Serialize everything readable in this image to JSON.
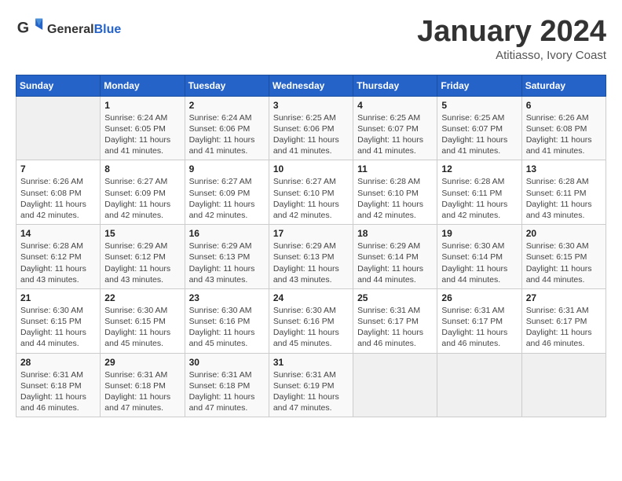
{
  "header": {
    "logo_general": "General",
    "logo_blue": "Blue",
    "month_title": "January 2024",
    "location": "Atitiasso, Ivory Coast"
  },
  "days_of_week": [
    "Sunday",
    "Monday",
    "Tuesday",
    "Wednesday",
    "Thursday",
    "Friday",
    "Saturday"
  ],
  "weeks": [
    [
      {
        "day": "",
        "info": ""
      },
      {
        "day": "1",
        "info": "Sunrise: 6:24 AM\nSunset: 6:05 PM\nDaylight: 11 hours and 41 minutes."
      },
      {
        "day": "2",
        "info": "Sunrise: 6:24 AM\nSunset: 6:06 PM\nDaylight: 11 hours and 41 minutes."
      },
      {
        "day": "3",
        "info": "Sunrise: 6:25 AM\nSunset: 6:06 PM\nDaylight: 11 hours and 41 minutes."
      },
      {
        "day": "4",
        "info": "Sunrise: 6:25 AM\nSunset: 6:07 PM\nDaylight: 11 hours and 41 minutes."
      },
      {
        "day": "5",
        "info": "Sunrise: 6:25 AM\nSunset: 6:07 PM\nDaylight: 11 hours and 41 minutes."
      },
      {
        "day": "6",
        "info": "Sunrise: 6:26 AM\nSunset: 6:08 PM\nDaylight: 11 hours and 41 minutes."
      }
    ],
    [
      {
        "day": "7",
        "info": "Sunrise: 6:26 AM\nSunset: 6:08 PM\nDaylight: 11 hours and 42 minutes."
      },
      {
        "day": "8",
        "info": "Sunrise: 6:27 AM\nSunset: 6:09 PM\nDaylight: 11 hours and 42 minutes."
      },
      {
        "day": "9",
        "info": "Sunrise: 6:27 AM\nSunset: 6:09 PM\nDaylight: 11 hours and 42 minutes."
      },
      {
        "day": "10",
        "info": "Sunrise: 6:27 AM\nSunset: 6:10 PM\nDaylight: 11 hours and 42 minutes."
      },
      {
        "day": "11",
        "info": "Sunrise: 6:28 AM\nSunset: 6:10 PM\nDaylight: 11 hours and 42 minutes."
      },
      {
        "day": "12",
        "info": "Sunrise: 6:28 AM\nSunset: 6:11 PM\nDaylight: 11 hours and 42 minutes."
      },
      {
        "day": "13",
        "info": "Sunrise: 6:28 AM\nSunset: 6:11 PM\nDaylight: 11 hours and 43 minutes."
      }
    ],
    [
      {
        "day": "14",
        "info": "Sunrise: 6:28 AM\nSunset: 6:12 PM\nDaylight: 11 hours and 43 minutes."
      },
      {
        "day": "15",
        "info": "Sunrise: 6:29 AM\nSunset: 6:12 PM\nDaylight: 11 hours and 43 minutes."
      },
      {
        "day": "16",
        "info": "Sunrise: 6:29 AM\nSunset: 6:13 PM\nDaylight: 11 hours and 43 minutes."
      },
      {
        "day": "17",
        "info": "Sunrise: 6:29 AM\nSunset: 6:13 PM\nDaylight: 11 hours and 43 minutes."
      },
      {
        "day": "18",
        "info": "Sunrise: 6:29 AM\nSunset: 6:14 PM\nDaylight: 11 hours and 44 minutes."
      },
      {
        "day": "19",
        "info": "Sunrise: 6:30 AM\nSunset: 6:14 PM\nDaylight: 11 hours and 44 minutes."
      },
      {
        "day": "20",
        "info": "Sunrise: 6:30 AM\nSunset: 6:15 PM\nDaylight: 11 hours and 44 minutes."
      }
    ],
    [
      {
        "day": "21",
        "info": "Sunrise: 6:30 AM\nSunset: 6:15 PM\nDaylight: 11 hours and 44 minutes."
      },
      {
        "day": "22",
        "info": "Sunrise: 6:30 AM\nSunset: 6:15 PM\nDaylight: 11 hours and 45 minutes."
      },
      {
        "day": "23",
        "info": "Sunrise: 6:30 AM\nSunset: 6:16 PM\nDaylight: 11 hours and 45 minutes."
      },
      {
        "day": "24",
        "info": "Sunrise: 6:30 AM\nSunset: 6:16 PM\nDaylight: 11 hours and 45 minutes."
      },
      {
        "day": "25",
        "info": "Sunrise: 6:31 AM\nSunset: 6:17 PM\nDaylight: 11 hours and 46 minutes."
      },
      {
        "day": "26",
        "info": "Sunrise: 6:31 AM\nSunset: 6:17 PM\nDaylight: 11 hours and 46 minutes."
      },
      {
        "day": "27",
        "info": "Sunrise: 6:31 AM\nSunset: 6:17 PM\nDaylight: 11 hours and 46 minutes."
      }
    ],
    [
      {
        "day": "28",
        "info": "Sunrise: 6:31 AM\nSunset: 6:18 PM\nDaylight: 11 hours and 46 minutes."
      },
      {
        "day": "29",
        "info": "Sunrise: 6:31 AM\nSunset: 6:18 PM\nDaylight: 11 hours and 47 minutes."
      },
      {
        "day": "30",
        "info": "Sunrise: 6:31 AM\nSunset: 6:18 PM\nDaylight: 11 hours and 47 minutes."
      },
      {
        "day": "31",
        "info": "Sunrise: 6:31 AM\nSunset: 6:19 PM\nDaylight: 11 hours and 47 minutes."
      },
      {
        "day": "",
        "info": ""
      },
      {
        "day": "",
        "info": ""
      },
      {
        "day": "",
        "info": ""
      }
    ]
  ]
}
